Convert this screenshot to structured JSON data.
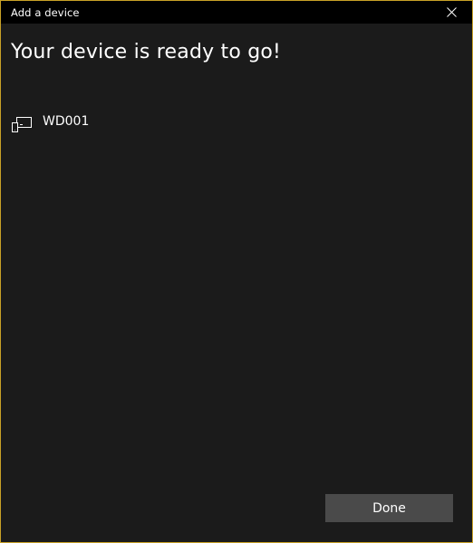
{
  "window": {
    "title": "Add a device",
    "accent_border_color": "#c9a227",
    "background_color": "#1b1b1b",
    "titlebar_color": "#000000"
  },
  "titlebar": {
    "close_icon": "close-icon"
  },
  "main": {
    "heading": "Your device is ready to go!",
    "devices": [
      {
        "icon": "display-device-icon",
        "name": "WD001"
      }
    ]
  },
  "footer": {
    "done_label": "Done",
    "done_button_color": "#4a4a4a"
  }
}
